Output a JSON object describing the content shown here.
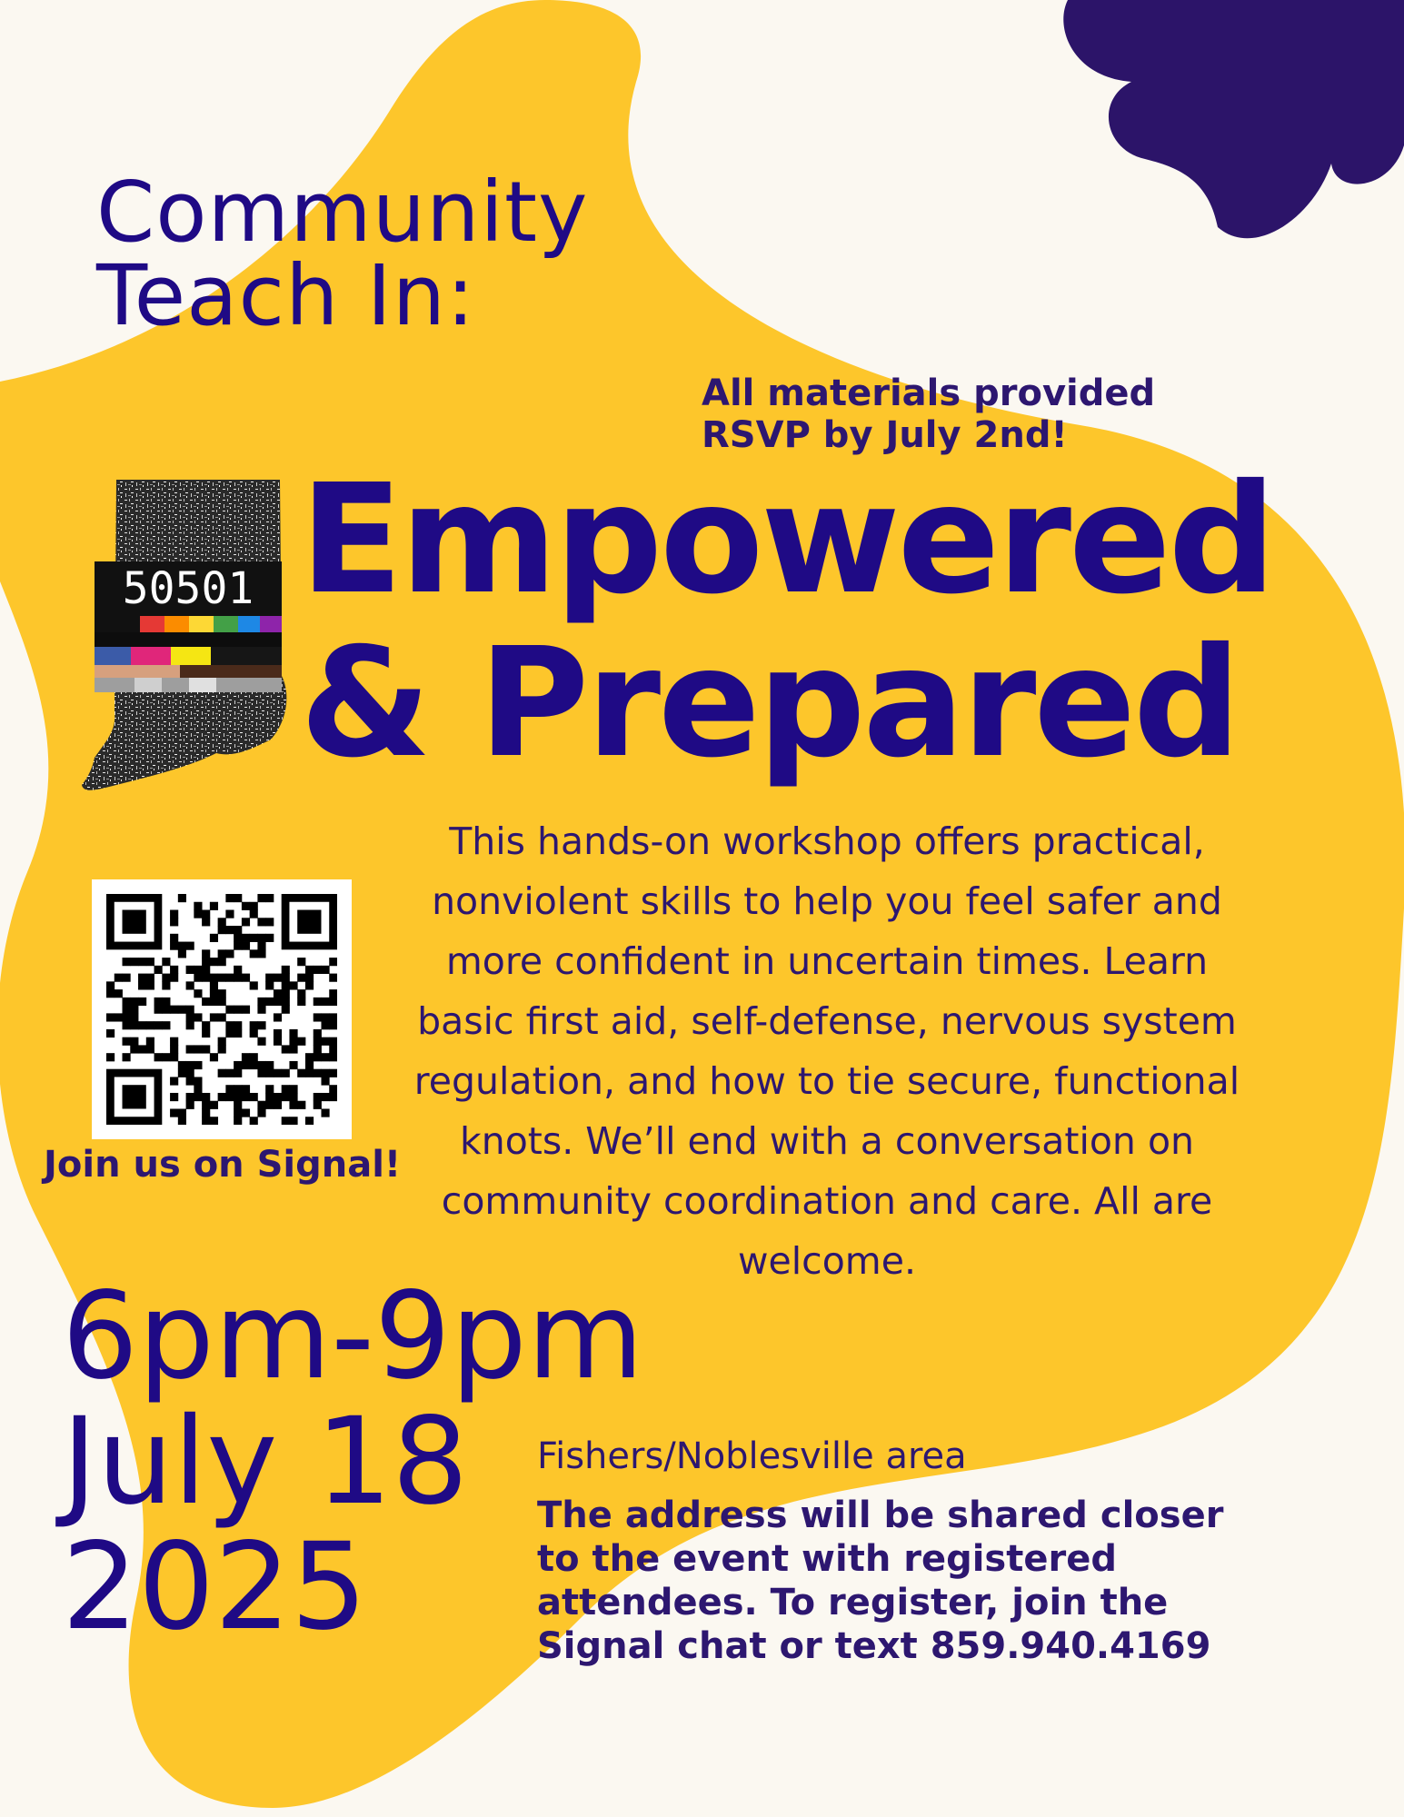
{
  "flyer": {
    "kicker_line1": "Community",
    "kicker_line2": "Teach In:",
    "materials_line1": "All materials provided",
    "materials_line2": "RSVP by July 2nd!",
    "headline_line1": "Empowered",
    "headline_line2": "& Prepared",
    "badge_code": "50501",
    "description": "This hands-on workshop offers practical, nonviolent skills to help you feel safer and more confident in uncertain times. Learn basic first aid, self-defense, nervous system regulation, and how to tie secure, functional knots. We’ll end with a conversation on community coordination and care. All are welcome.",
    "qr_caption": "Join us on Signal!",
    "time": "6pm-9pm",
    "date": "July 18",
    "year": "2025",
    "area": "Fishers/Noblesville area",
    "address_note": "The address will be shared closer to the event with registered attendees. To register, join the Signal chat or text 859.940.4169"
  },
  "colors": {
    "background": "#FBF8F1",
    "blob": "#FDC62B",
    "primary_text": "#1F0A85",
    "secondary_text": "#2D1770",
    "flower": "#2C1469"
  },
  "icons": {
    "corner_shape": "flower-shape-icon",
    "state_logo": "indiana-50501-logo-icon",
    "qr": "qr-code-icon"
  }
}
